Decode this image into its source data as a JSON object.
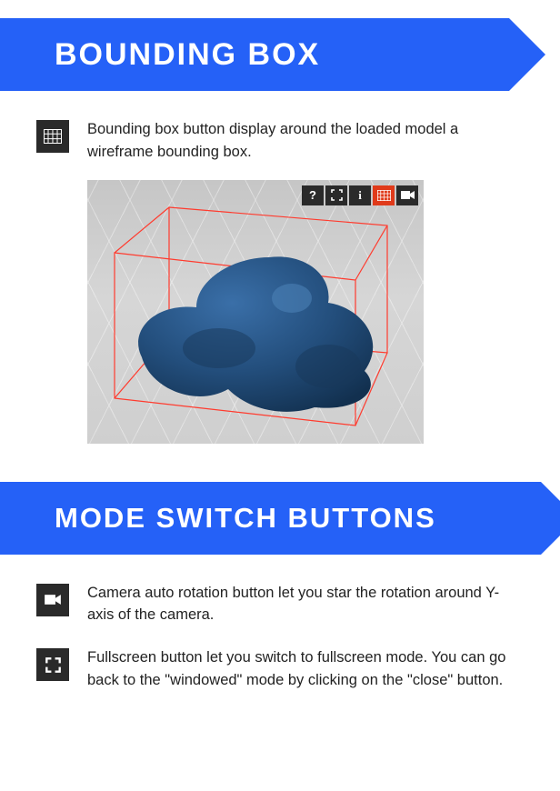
{
  "section1": {
    "title": "BOUNDING BOX",
    "item1": {
      "icon": "grid-icon",
      "text": "Bounding box button display around the loaded model a wireframe bounding box."
    }
  },
  "section2": {
    "title": "MODE SWITCH BUTTONS",
    "item1": {
      "icon": "camera-icon",
      "text": "Camera auto rotation button let you star the rotation around Y-axis of the camera."
    },
    "item2": {
      "icon": "fullscreen-icon",
      "text": "Fullscreen button let you switch to fullscreen mode. You can go back to the \"windowed\" mode by clicking on the \"close\" button."
    }
  },
  "viewer": {
    "toolbar": {
      "help": "?",
      "fullscreen": "fullscreen",
      "info": "i",
      "grid": "grid",
      "camera": "camera"
    }
  }
}
